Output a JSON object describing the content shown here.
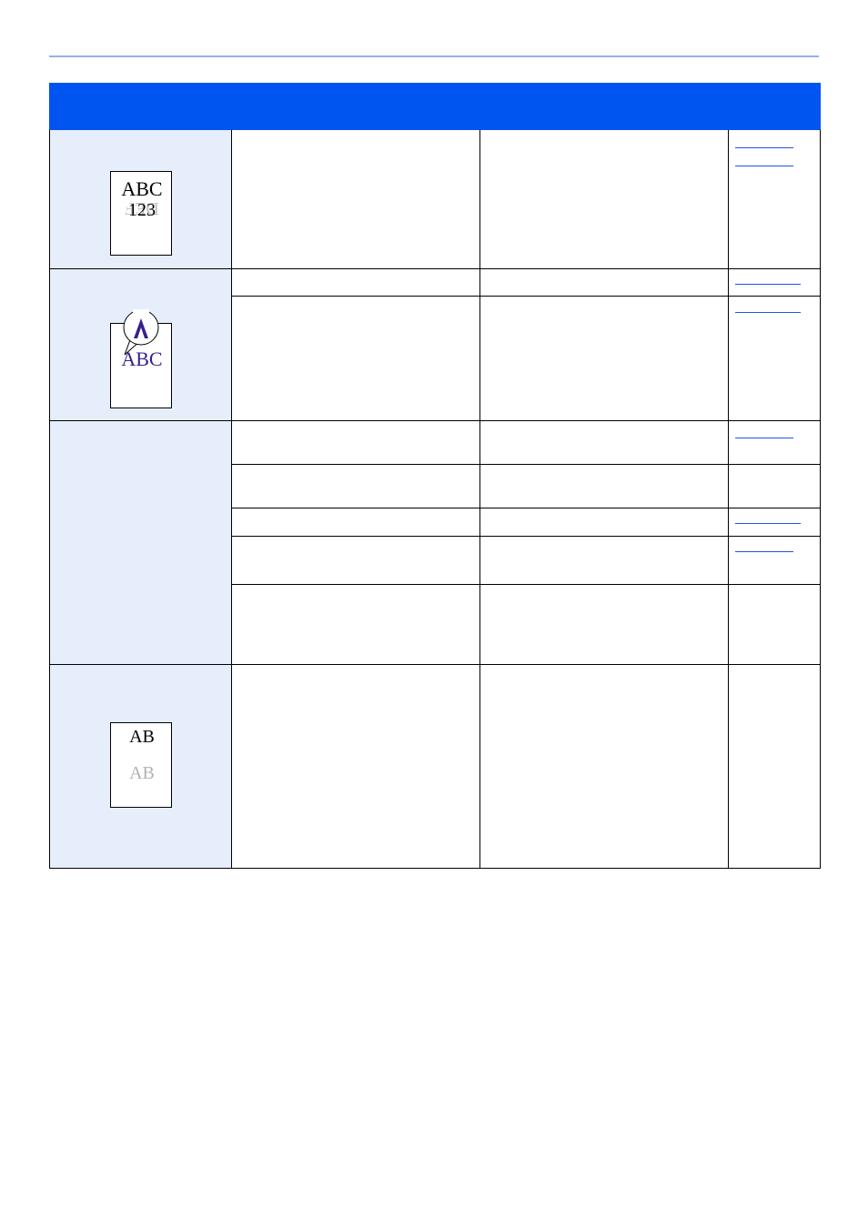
{
  "samples": {
    "sample1": {
      "line1": "ABC",
      "line2": "123",
      "ghost": "DEF"
    },
    "sample2": {
      "text": "ABC"
    },
    "sample4": {
      "dark": "AB",
      "light": "AB"
    }
  },
  "colors": {
    "header": "#0054f0",
    "image_column": "#e6edfb",
    "link": "#1a56e8",
    "rule": "#8fb3ec"
  }
}
